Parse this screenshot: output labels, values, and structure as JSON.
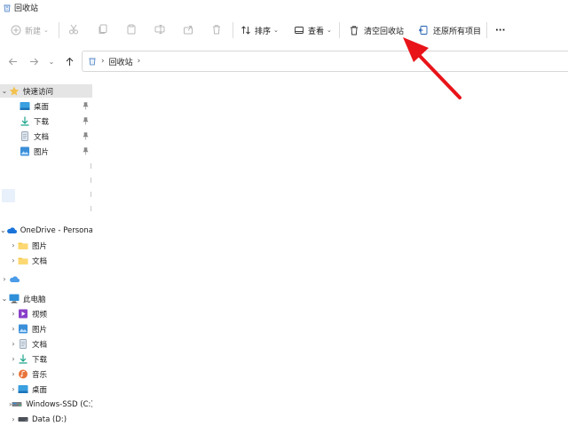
{
  "window": {
    "title": "回收站"
  },
  "toolbar": {
    "new_label": "新建",
    "sort_label": "排序",
    "view_label": "查看",
    "empty_recycle_bin_label": "清空回收站",
    "restore_all_label": "还原所有项目",
    "more_label": "···"
  },
  "address": {
    "crumbs": [
      "回收站"
    ]
  },
  "sidebar": {
    "quick_access": {
      "label": "快速访问",
      "items": [
        {
          "label": "桌面",
          "icon": "desktop-folder-icon"
        },
        {
          "label": "下载",
          "icon": "download-icon"
        },
        {
          "label": "文档",
          "icon": "documents-icon"
        },
        {
          "label": "图片",
          "icon": "pictures-icon"
        }
      ]
    },
    "onedrive": {
      "label": "OneDrive - Persona",
      "items": [
        {
          "label": "图片",
          "icon": "folder-icon"
        },
        {
          "label": "文档",
          "icon": "folder-icon"
        }
      ]
    },
    "this_pc": {
      "label": "此电脑",
      "items": [
        {
          "label": "视频",
          "icon": "videos-icon"
        },
        {
          "label": "图片",
          "icon": "pictures-icon"
        },
        {
          "label": "文档",
          "icon": "documents-icon"
        },
        {
          "label": "下载",
          "icon": "download-icon"
        },
        {
          "label": "音乐",
          "icon": "music-icon"
        },
        {
          "label": "桌面",
          "icon": "desktop-folder-icon"
        },
        {
          "label": "Windows-SSD (C:)",
          "icon": "drive-icon"
        },
        {
          "label": "Data (D:)",
          "icon": "drive-icon"
        }
      ]
    }
  },
  "colors": {
    "accent": "#0067c0",
    "annotation_arrow": "#e8141a",
    "folder_yellow": "#f7c948",
    "selected_bg": "#e5e5e5"
  }
}
